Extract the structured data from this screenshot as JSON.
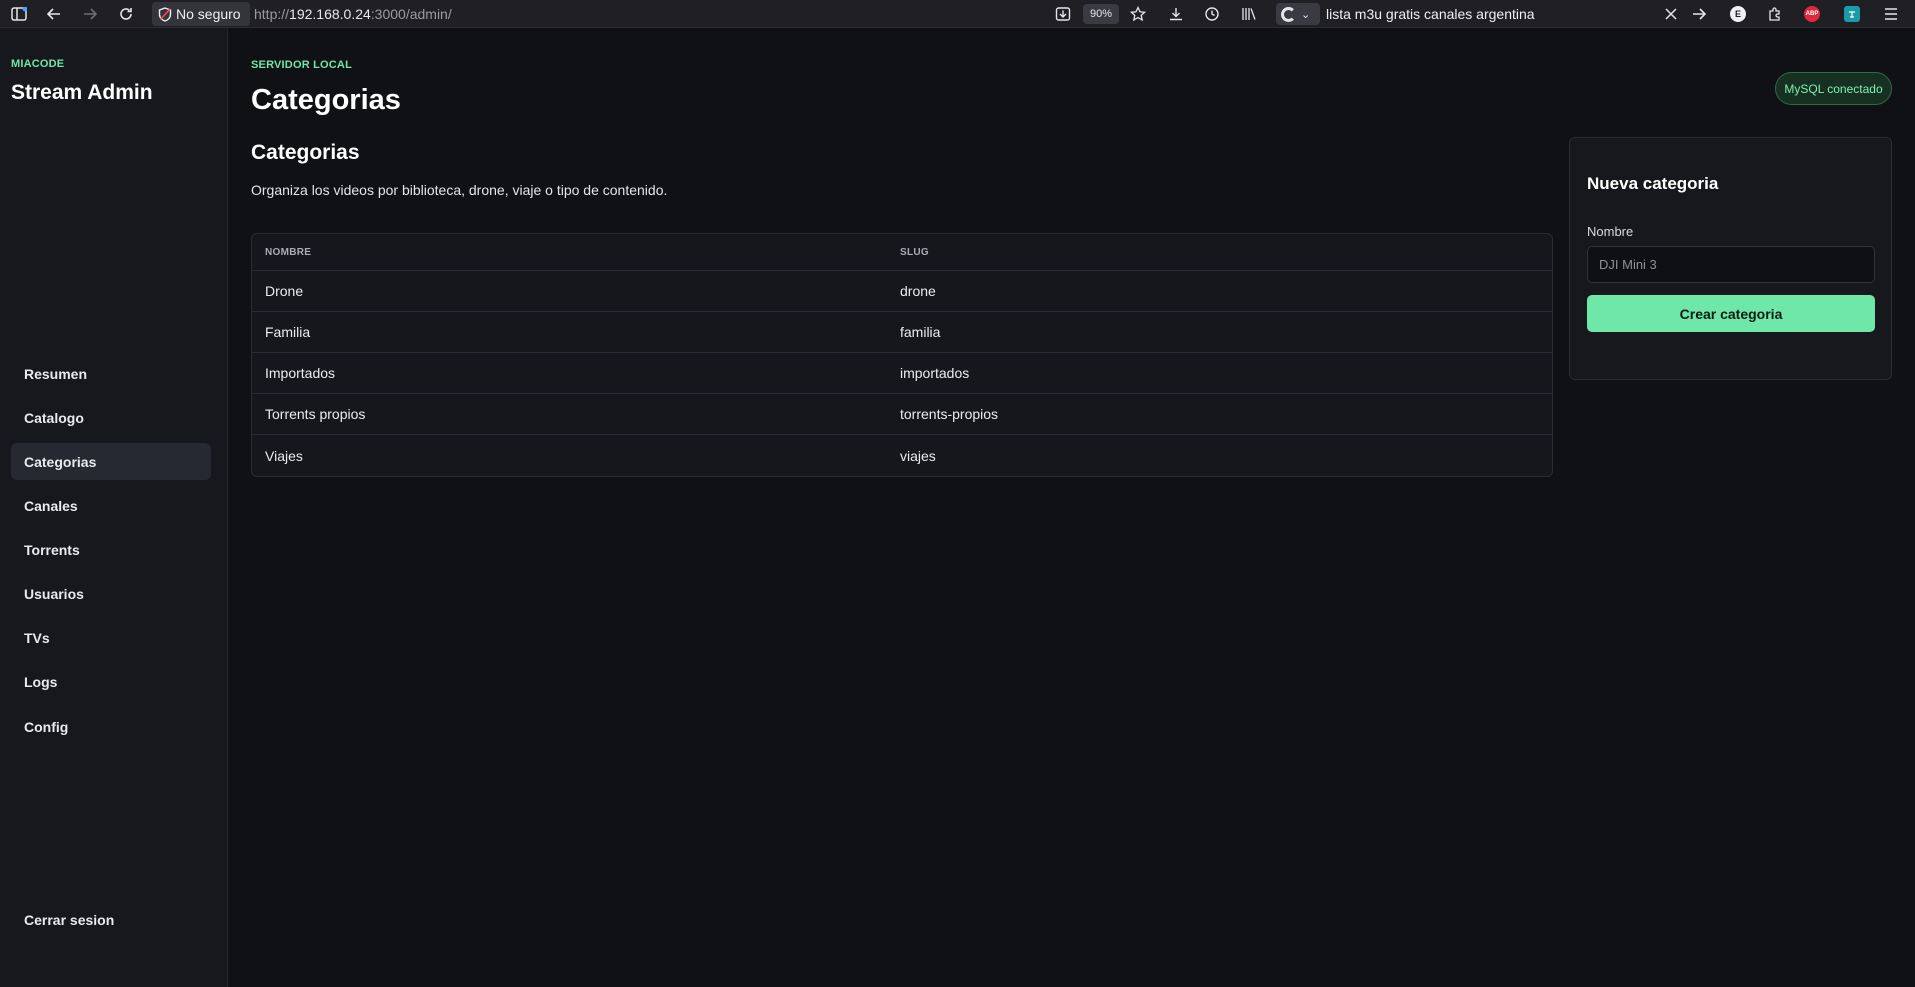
{
  "browser": {
    "security_label": "No seguro",
    "url_prefix": "http://",
    "url_host": "192.168.0.24",
    "url_rest": ":3000/admin/",
    "zoom": "90%",
    "search_query": "lista m3u gratis canales argentina",
    "ext_e": "E",
    "ext_abp": "ABP"
  },
  "sidebar": {
    "brand_small": "MIACODE",
    "brand": "Stream Admin",
    "items": [
      {
        "label": "Resumen"
      },
      {
        "label": "Catalogo"
      },
      {
        "label": "Categorias",
        "active": true
      },
      {
        "label": "Canales"
      },
      {
        "label": "Torrents"
      },
      {
        "label": "Usuarios"
      },
      {
        "label": "TVs"
      },
      {
        "label": "Logs"
      },
      {
        "label": "Config"
      }
    ],
    "logout": "Cerrar sesion"
  },
  "header": {
    "eyebrow": "SERVIDOR LOCAL",
    "title": "Categorias",
    "status": "MySQL conectado"
  },
  "section": {
    "title": "Categorias",
    "description": "Organiza los videos por biblioteca, drone, viaje o tipo de contenido."
  },
  "table": {
    "columns": [
      "NOMBRE",
      "SLUG"
    ],
    "rows": [
      [
        "Drone",
        "drone"
      ],
      [
        "Familia",
        "familia"
      ],
      [
        "Importados",
        "importados"
      ],
      [
        "Torrents propios",
        "torrents-propios"
      ],
      [
        "Viajes",
        "viajes"
      ]
    ]
  },
  "form": {
    "title": "Nueva categoria",
    "label": "Nombre",
    "placeholder": "DJI Mini 3",
    "submit": "Crear categoria"
  },
  "colors": {
    "accent": "#6ee7a8",
    "background": "#101115",
    "sidebar": "#17181d"
  }
}
